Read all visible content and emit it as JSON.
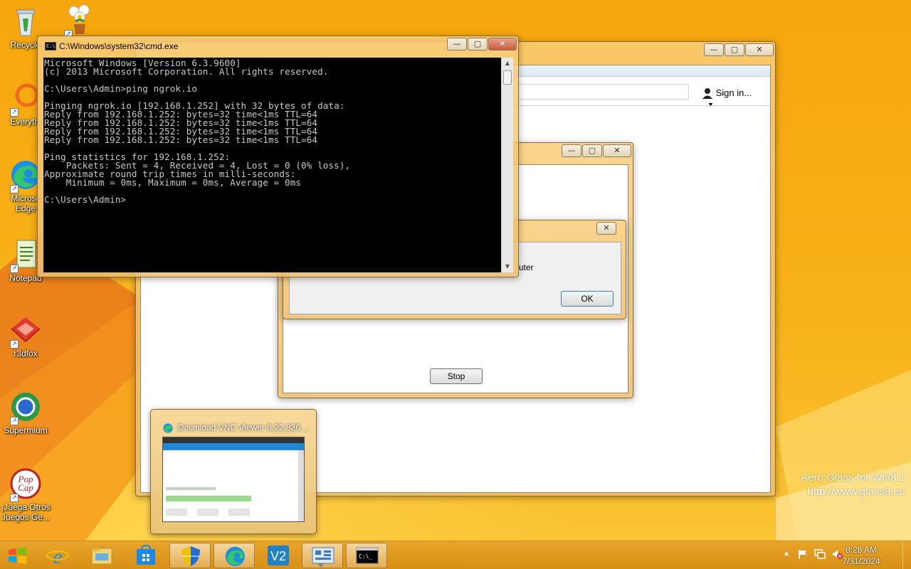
{
  "desktop": {
    "icons": [
      {
        "label": "Recycle"
      },
      {
        "label": ""
      },
      {
        "label": "Everythi"
      },
      {
        "label": "Microsc Edge"
      },
      {
        "label": "Notepad"
      },
      {
        "label": "r3dfox"
      },
      {
        "label": "Supermium"
      },
      {
        "label": "¡Juega Otros Juegos Ge..."
      }
    ],
    "watermark": {
      "line1": "Aero Glass for Win8.1",
      "line2": "http://www.glass8.eu"
    }
  },
  "cmd_window": {
    "title": "C:\\Windows\\system32\\cmd.exe",
    "lines": [
      "Microsoft Windows [Version 6.3.9600]",
      "(c) 2013 Microsoft Corporation. All rights reserved.",
      "",
      "C:\\Users\\Admin>ping ngrok.io",
      "",
      "Pinging ngrok.io [192.168.1.252] with 32 bytes of data:",
      "Reply from 192.168.1.252: bytes=32 time<1ms TTL=64",
      "Reply from 192.168.1.252: bytes=32 time<1ms TTL=64",
      "Reply from 192.168.1.252: bytes=32 time<1ms TTL=64",
      "Reply from 192.168.1.252: bytes=32 time<1ms TTL=64",
      "",
      "Ping statistics for 192.168.1.252:",
      "    Packets: Sent = 4, Received = 4, Lost = 0 (0% loss),",
      "Approximate round trip times in milli-seconds:",
      "    Minimum = 0ms, Maximum = 0ms, Average = 0ms",
      "",
      "C:\\Users\\Admin>"
    ]
  },
  "browser_window": {
    "sign_in_label": "Sign in..."
  },
  "dialog": {
    "partial_text": "uter",
    "ok_label": "OK"
  },
  "progress_window": {
    "stop_label": "Stop"
  },
  "taskbar": {
    "preview_title": "Download VNC Viewer 6.22.826 ...",
    "clock_time": "8:28 AM",
    "clock_date": "7/31/2024"
  }
}
